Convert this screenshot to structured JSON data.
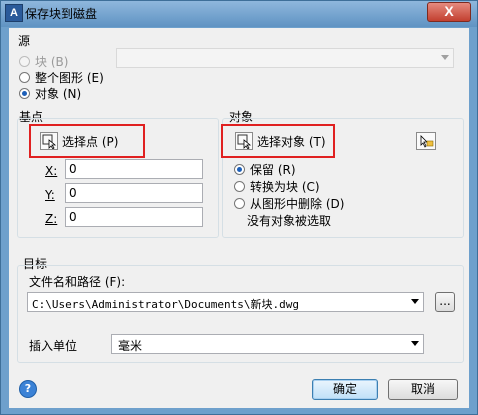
{
  "window": {
    "title": "保存块到磁盘",
    "close_label": "X"
  },
  "source": {
    "title": "源",
    "options": [
      "块 (B)",
      "整个图形 (E)",
      "对象 (N)"
    ],
    "selected": "对象 (N)"
  },
  "base_point": {
    "title": "基点",
    "pick_label": "选择点 (P)",
    "x_label": "X:",
    "y_label": "Y:",
    "z_label": "Z:",
    "x_value": "0",
    "y_value": "0",
    "z_value": "0"
  },
  "objects": {
    "title": "对象",
    "select_label": "选择对象 (T)",
    "options": [
      "保留 (R)",
      "转换为块 (C)",
      "从图形中删除 (D)"
    ],
    "selected": "保留 (R)",
    "status": "没有对象被选取"
  },
  "destination": {
    "title": "目标",
    "path_label": "文件名和路径 (F):",
    "path_value": "C:\\Users\\Administrator\\Documents\\新块.dwg",
    "browse_label": "...",
    "units_label": "插入单位",
    "units_value": "毫米"
  },
  "footer": {
    "ok_label": "确定",
    "cancel_label": "取消",
    "help_label": "?"
  },
  "colors": {
    "title_bar": "#6ea0cc",
    "client_bg": "#f0f0f0",
    "highlight": "#e02020"
  }
}
